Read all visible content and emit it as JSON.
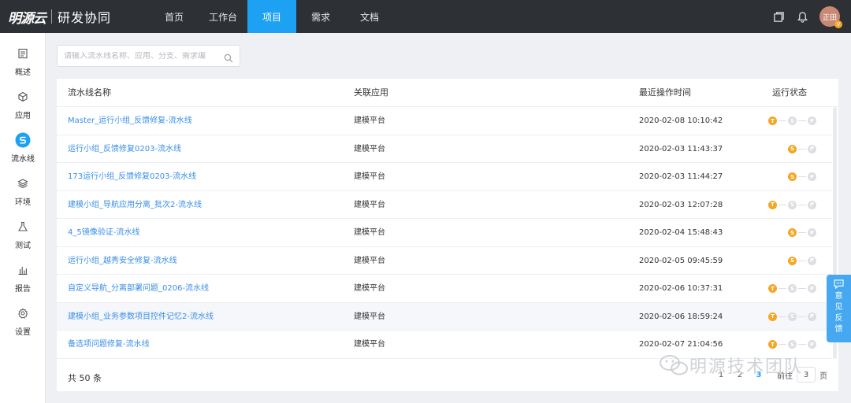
{
  "brand": {
    "logo": "明源云",
    "product": "研发协同"
  },
  "nav": [
    {
      "label": "首页",
      "active": false
    },
    {
      "label": "工作台",
      "active": false
    },
    {
      "label": "项目",
      "active": true
    },
    {
      "label": "需求",
      "active": false
    },
    {
      "label": "文档",
      "active": false
    }
  ],
  "user": {
    "avatar_text": "正田",
    "badge": "V"
  },
  "sidebar": [
    {
      "label": "概述",
      "icon": "document-icon"
    },
    {
      "label": "应用",
      "icon": "cube-icon"
    },
    {
      "label": "流水线",
      "icon": "pipeline-icon",
      "active": true
    },
    {
      "label": "环境",
      "icon": "layers-icon"
    },
    {
      "label": "测试",
      "icon": "flask-icon"
    },
    {
      "label": "报告",
      "icon": "bar-chart-icon"
    },
    {
      "label": "设置",
      "icon": "gear-icon"
    }
  ],
  "search": {
    "placeholder": "请输入流水线名称、应用、分支、需求编"
  },
  "table": {
    "headers": [
      "流水线名称",
      "关联应用",
      "最近操作时间",
      "运行状态"
    ],
    "rows": [
      {
        "name": "Master_运行小组_反馈修复-流水线",
        "app": "建模平台",
        "time": "2020-02-08 10:10:42",
        "status": [
          "T",
          "S",
          "P"
        ],
        "active_stage": "T"
      },
      {
        "name": "运行小组_反馈修复0203-流水线",
        "app": "建模平台",
        "time": "2020-02-03 11:43:37",
        "status": [
          "S",
          "P"
        ],
        "active_stage": "S"
      },
      {
        "name": "173运行小组_反馈修复0203-流水线",
        "app": "建模平台",
        "time": "2020-02-03 11:44:27",
        "status": [
          "S",
          "P"
        ],
        "active_stage": "S"
      },
      {
        "name": "建模小组_导航应用分离_批次2-流水线",
        "app": "建模平台",
        "time": "2020-02-03 12:07:28",
        "status": [
          "T",
          "S",
          "P"
        ],
        "active_stage": "T"
      },
      {
        "name": "4_5镜像验证-流水线",
        "app": "建模平台",
        "time": "2020-02-04 15:48:43",
        "status": [
          "S",
          "P"
        ],
        "active_stage": "S"
      },
      {
        "name": "运行小组_越秀安全修复-流水线",
        "app": "建模平台",
        "time": "2020-02-05 09:45:59",
        "status": [
          "S",
          "P"
        ],
        "active_stage": "S"
      },
      {
        "name": "自定义导航_分离部署问题_0206-流水线",
        "app": "建模平台",
        "time": "2020-02-06 10:37:31",
        "status": [
          "T",
          "S",
          "P"
        ],
        "active_stage": "T"
      },
      {
        "name": "建模小组_业务参数项目控件记忆2-流水线",
        "app": "建模平台",
        "time": "2020-02-06 18:59:24",
        "status": [
          "T",
          "S",
          "P"
        ],
        "active_stage": "T"
      },
      {
        "name": "备选项问题修复-流水线",
        "app": "建模平台",
        "time": "2020-02-07 21:04:56",
        "status": [
          "T",
          "S",
          "P"
        ],
        "active_stage": "T"
      }
    ]
  },
  "footer": {
    "total": "共 50 条",
    "pages": [
      "1",
      "2",
      "3"
    ],
    "current_page": "3",
    "goto_label": "前往",
    "goto_value": "3",
    "page_unit": "页"
  },
  "feedback": {
    "label": "意见反馈"
  },
  "watermark": {
    "text": "明源技术团队"
  },
  "colors": {
    "accent": "#1da1f2",
    "topbar": "#2d3035",
    "link": "#3a8ee6",
    "status_on": "#f5a623",
    "status_off": "#dcdee2"
  }
}
